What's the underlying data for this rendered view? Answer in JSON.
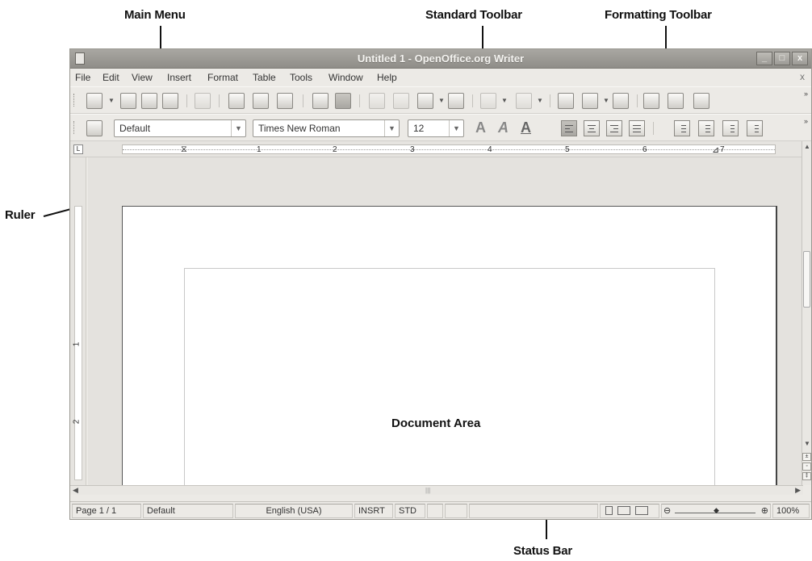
{
  "annotations": {
    "main_menu": "Main Menu",
    "standard_toolbar": "Standard Toolbar",
    "formatting_toolbar": "Formatting Toolbar",
    "ruler": "Ruler",
    "document_area": "Document Area",
    "status_bar": "Status Bar"
  },
  "window": {
    "title": "Untitled 1 - OpenOffice.org Writer",
    "buttons": {
      "minimize": "_",
      "maximize": "□",
      "close": "x"
    }
  },
  "menubar": {
    "items": [
      "File",
      "Edit",
      "View",
      "Insert",
      "Format",
      "Table",
      "Tools",
      "Window",
      "Help"
    ],
    "close": "x"
  },
  "standard_toolbar": {
    "icons": [
      "new-document-icon",
      "open-icon",
      "save-icon",
      "email-icon",
      "edit-file-icon",
      "export-pdf-icon",
      "print-icon",
      "page-preview-icon",
      "spellcheck-icon",
      "autospellcheck-icon",
      "cut-icon",
      "copy-icon",
      "paste-icon",
      "clone-formatting-icon",
      "undo-icon",
      "redo-icon",
      "hyperlink-icon",
      "table-icon",
      "show-draw-functions-icon",
      "navigator-icon",
      "gallery-icon",
      "data-sources-icon"
    ],
    "overflow": "»"
  },
  "formatting_toolbar": {
    "style": "Default",
    "font": "Times New Roman",
    "size": "12",
    "overflow": "»"
  },
  "ruler": {
    "numbers": [
      "1",
      "2",
      "3",
      "4",
      "5",
      "6",
      "7"
    ],
    "vertical_numbers": [
      "1",
      "2"
    ]
  },
  "statusbar": {
    "page": "Page 1 / 1",
    "style": "Default",
    "language": "English (USA)",
    "insert_mode": "INSRT",
    "selection_mode": "STD",
    "zoom": "100%"
  }
}
